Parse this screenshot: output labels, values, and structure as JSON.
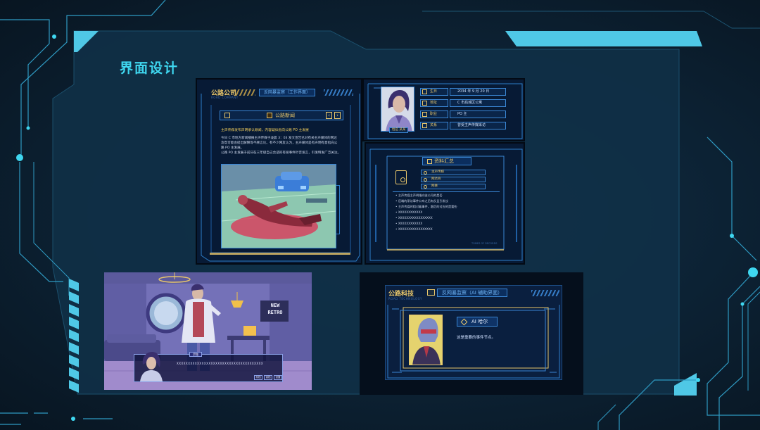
{
  "page": {
    "title": "界面设计"
  },
  "news_panel": {
    "brand": "公路公司",
    "brand_en": "ROAD COMPANY",
    "tab": "反网暴监察（工作界面）",
    "section": "公路新闻",
    "nav_prev": "‹",
    "nav_next": "›",
    "headline": "主声传媒发布声明承认跌闻，内容疑似指向公路 PO 主发展",
    "body_lines": [
      "今日 C 市地方新闻播报主声传媒于凌晨 3：03 发文宣告已对有关主声媒体的网达",
      "及帮可能会提出解释等不顾言论。有不少网友认为，主声媒体是有声明有意指向公",
      "路 PO 主发展。",
      "公路 PO 主发展于前日在三年级自己合适的有很事件针否发言，引发特发广泛关注。"
    ]
  },
  "profile_panel": {
    "name_tag": "姓名 某某",
    "fields": [
      {
        "label": "生日",
        "value": "2034 年 9 月 20 日",
        "icon": "calendar-icon"
      },
      {
        "label": "地址",
        "value": "C 市后城区公寓",
        "icon": "home-icon"
      },
      {
        "label": "职业",
        "value": "PO 主",
        "icon": "briefcase-icon"
      },
      {
        "label": "关系",
        "value": "曾受主声传媒采访",
        "icon": "people-icon"
      }
    ]
  },
  "summary_panel": {
    "title": "资料汇总",
    "items": [
      "主声传媒",
      "网达商",
      "网暴"
    ],
    "bullets": [
      "主声传媒主声明指向该公司的是否",
      "后端的采访事件公布之后有反且引发议",
      "主声传媒时相对着事件，跟后的对应的是要些",
      "XXXXXXXXXXXX",
      "XXXXXXXXXXXXXXXXX",
      "XXXXXXXXXXXX",
      "XXXXXXXXXXXXXXXXX"
    ],
    "footer": "TOMES OF RECORDS"
  },
  "game_scene": {
    "sign_line1": "NEW",
    "sign_line2": "RETRO",
    "speaker": "伊路",
    "dialogue": "XXXXXXXXXXXXXXXXXXXXXXXXXXXXXXXXXXXXXX",
    "buttons": [
      "存档",
      "读档",
      "设置"
    ]
  },
  "ai_panel": {
    "brand": "公路科技",
    "brand_en": "ROAD TECHNOLOGY",
    "tab": "反网暴监察（AI 辅助界面）",
    "agent_name": "AI 哈尔",
    "message": "这是重要的事件节点。"
  },
  "colors": {
    "accent": "#3fd7f0",
    "gold": "#e8c66a",
    "frame": "#2d7ec9",
    "panel_bg": "#071a35"
  }
}
